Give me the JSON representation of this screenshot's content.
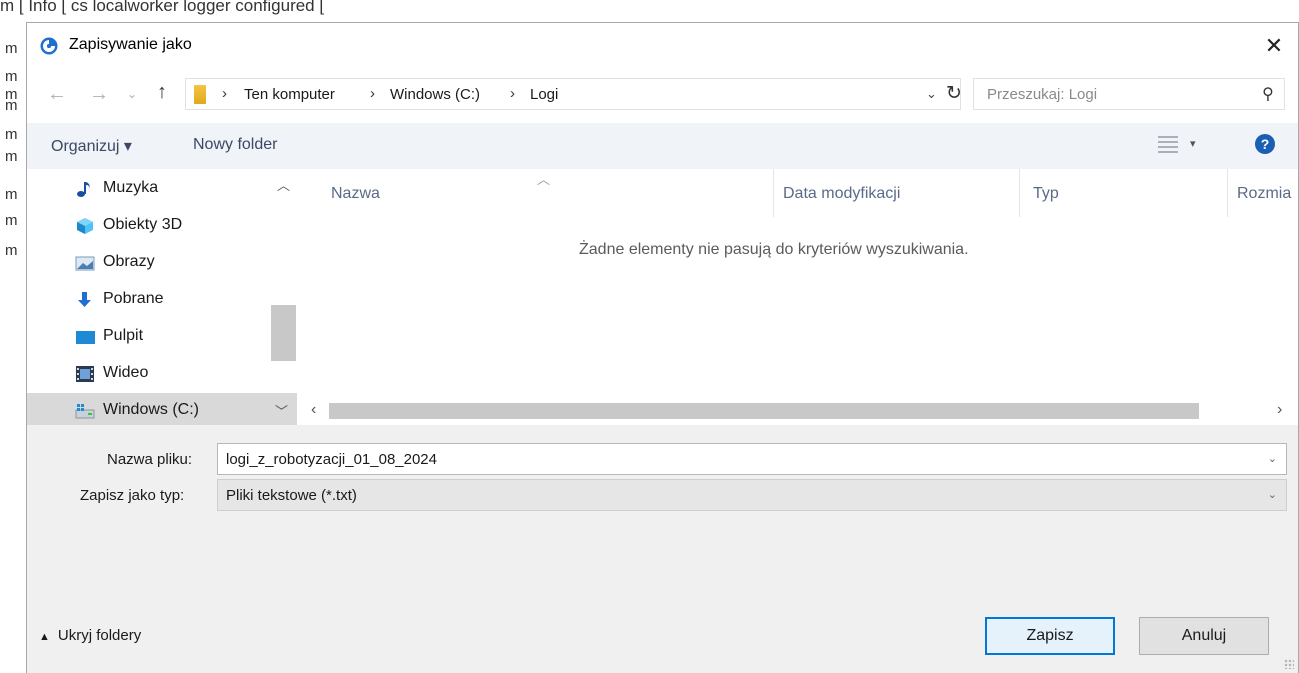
{
  "console": {
    "top_line": "m [ Info [ cs localworker logger configured [",
    "line_prefix": "m"
  },
  "dialog": {
    "title": "Zapisywanie jako",
    "close_glyph": "✕"
  },
  "address": {
    "breadcrumbs": [
      "Ten komputer",
      "Windows (C:)",
      "Logi"
    ],
    "search_placeholder": "Przeszukaj: Logi"
  },
  "toolbar": {
    "organize_label": "Organizuj ▾",
    "new_folder_label": "Nowy folder"
  },
  "nav_pane": {
    "items": [
      {
        "label": "Muzyka",
        "icon": "music-icon"
      },
      {
        "label": "Obiekty 3D",
        "icon": "objects-3d-icon"
      },
      {
        "label": "Obrazy",
        "icon": "pictures-icon"
      },
      {
        "label": "Pobrane",
        "icon": "downloads-icon"
      },
      {
        "label": "Pulpit",
        "icon": "desktop-icon"
      },
      {
        "label": "Wideo",
        "icon": "video-icon"
      },
      {
        "label": "Windows (C:)",
        "icon": "drive-icon",
        "selected": true
      }
    ]
  },
  "file_list": {
    "columns": [
      "Nazwa",
      "Data modyfikacji",
      "Typ",
      "Rozmia"
    ],
    "empty_message": "Żadne elementy nie pasują do kryteriów wyszukiwania."
  },
  "form": {
    "filename_label": "Nazwa pliku:",
    "filename_value": "logi_z_robotyzacji_01_08_2024",
    "filetype_label": "Zapisz jako typ:",
    "filetype_value": "Pliki tekstowe (*.txt)"
  },
  "footer": {
    "hide_folders_label": "Ukryj foldery",
    "save_label": "Zapisz",
    "cancel_label": "Anuluj"
  },
  "colors": {
    "accent": "#0078d7",
    "toolbar_bg": "#f0f3f8",
    "selected_bg": "#d9d9d9",
    "help_icon": "#1a5fb4"
  }
}
